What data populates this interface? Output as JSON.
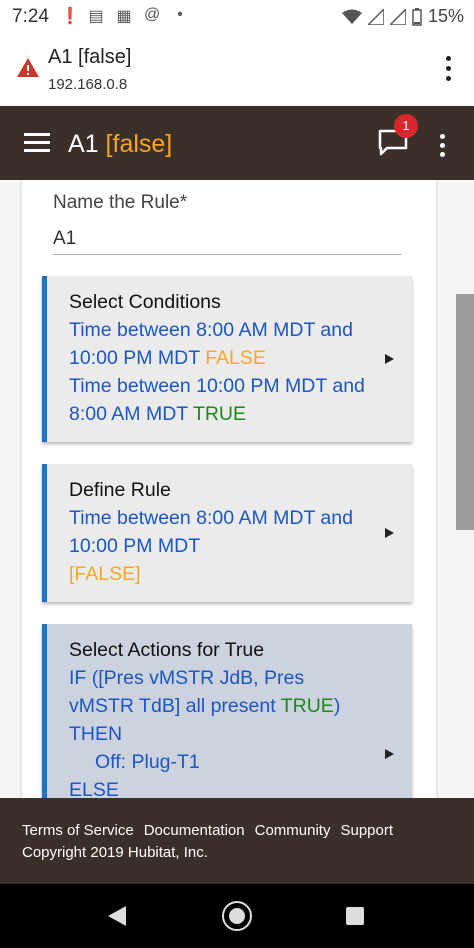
{
  "status_bar": {
    "time": "7:24",
    "battery": "15%",
    "icons": [
      "alert-icon",
      "news-icon",
      "calendar-icon",
      "at-icon",
      "dot-icon"
    ]
  },
  "browser": {
    "title": "A1 [false]",
    "host": "192.168.0.8"
  },
  "app_bar": {
    "title": "A1",
    "status": "[false]",
    "notification_count": "1"
  },
  "form": {
    "name_label": "Name the Rule*",
    "name_value": "A1"
  },
  "sections": {
    "conditions": {
      "heading": "Select Conditions",
      "line1": "Time between 8:00 AM MDT and 10:00 PM MDT",
      "line1_state": "FALSE",
      "line2": "Time between 10:00 PM MDT and 8:00 AM MDT",
      "line2_state": "TRUE"
    },
    "define": {
      "heading": "Define Rule",
      "line1": "Time between 8:00 AM MDT and 10:00 PM MDT",
      "state": "[FALSE]"
    },
    "actions": {
      "heading": "Select Actions for True",
      "if_text": "IF ([Pres vMSTR JdB, Pres vMSTR TdB] all present",
      "if_state": "TRUE",
      "if_close": ")",
      "then": "THEN",
      "action": "Off: Plug-T1",
      "else": "ELSE"
    }
  },
  "footer": {
    "links": [
      "Terms of Service",
      "Documentation",
      "Community",
      "Support"
    ],
    "copyright": "Copyright 2019 Hubitat, Inc."
  },
  "colors": {
    "app_bar": "#3a2f29",
    "accent_orange": "#f5a623",
    "link_blue": "#1a56c4",
    "true_green": "#1a8a1a",
    "section_border": "#1e73c9",
    "badge_red": "#d9262c"
  }
}
